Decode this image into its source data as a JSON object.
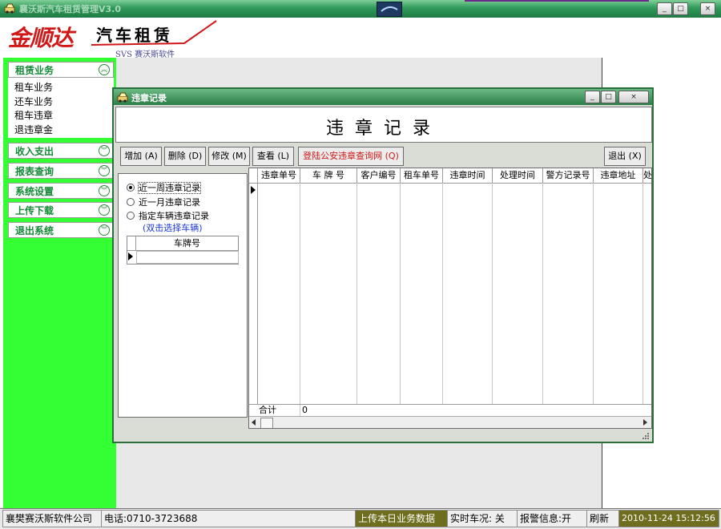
{
  "app": {
    "title": "襄沃斯汽车租赁管理V3.0",
    "brand_name": "金顺达",
    "brand_tagline": "汽车租赁",
    "brand_sub": "SVS 赛沃斯软件",
    "window_buttons": {
      "minimize": "_",
      "maximize": "□",
      "close": "×"
    }
  },
  "sidebar": {
    "sections": [
      {
        "label": "租赁业务",
        "expanded": true,
        "items": [
          "租车业务",
          "还车业务",
          "租车违章",
          "退违章金"
        ]
      },
      {
        "label": "收入支出",
        "expanded": false
      },
      {
        "label": "报表查询",
        "expanded": false
      },
      {
        "label": "系统设置",
        "expanded": false
      },
      {
        "label": "上传下载",
        "expanded": false
      },
      {
        "label": "退出系统",
        "expanded": false
      }
    ]
  },
  "violation_window": {
    "title": "违章记录",
    "banner": "违章记录",
    "toolbar": {
      "add": "增加 (A)",
      "delete": "删除 (D)",
      "edit": "修改 (M)",
      "view": "查看 (L)",
      "police_site": "登陆公安违章查询网 (Q)",
      "exit": "退出 (X)"
    },
    "filters": {
      "options": [
        "近一周违章记录",
        "近一月违章记录",
        "指定车辆违章记录"
      ],
      "selected": "近一周违章记录",
      "hint": "(双击选择车辆)",
      "plate_column": "车牌号"
    },
    "grid": {
      "columns": [
        "违章单号",
        "车 牌 号",
        "客户编号",
        "租车单号",
        "违章时间",
        "处理时间",
        "警方记录号",
        "违章地址",
        "处"
      ],
      "total_label": "合计",
      "total_value": "0"
    }
  },
  "statusbar": {
    "company": "襄樊赛沃斯软件公司",
    "phone": "电话:0710-3723688",
    "upload": "上传本日业务数据",
    "realtime": "实时车况: 关",
    "alarm": "报警信息:开",
    "refresh": "刷新",
    "datetime": "2010-11-24 15:12:56"
  },
  "colors": {
    "accent_green": "#33ff33",
    "title_green": "#2f9a5a",
    "brand_red": "#d01818",
    "link_blue": "#1a37d8",
    "warn_red": "#d01818"
  }
}
